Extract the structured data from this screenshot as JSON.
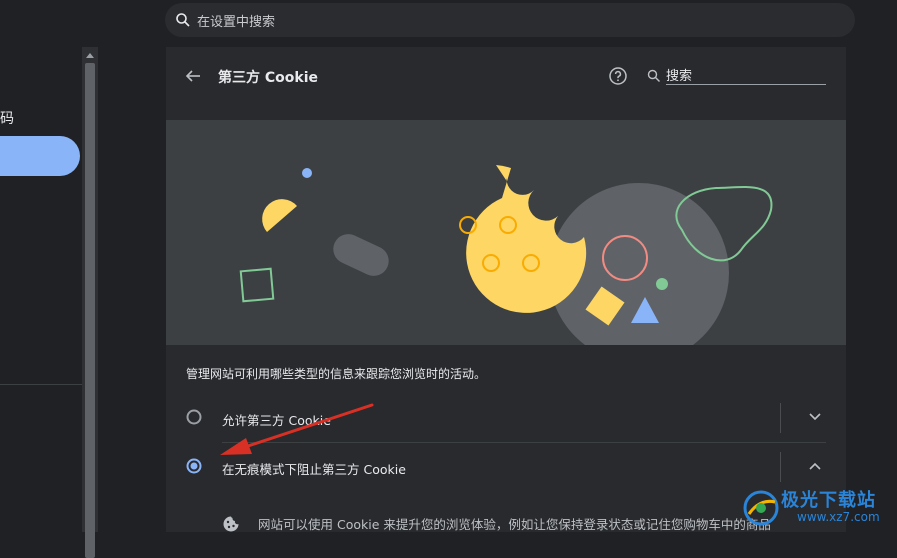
{
  "top_search": {
    "placeholder": "在设置中搜索",
    "icon": "search-icon"
  },
  "sidebar": {
    "partial_label": "码"
  },
  "page": {
    "title": "第三方 Cookie",
    "search_value": "搜索",
    "description": "管理网站可利用哪些类型的信息来跟踪您浏览时的活动。"
  },
  "options": [
    {
      "label": "允许第三方 Cookie",
      "selected": false,
      "expanded": false
    },
    {
      "label": "在无痕模式下阻止第三方 Cookie",
      "selected": true,
      "expanded": true
    }
  ],
  "detail": {
    "text": "网站可以使用 Cookie 来提升您的浏览体验，例如让您保持登录状态或记住您购物车中的商品"
  },
  "watermark": {
    "title": "极光下载站",
    "url": "www.xz7.com"
  },
  "colors": {
    "accent": "#8ab4f8",
    "background": "#202124",
    "panel": "#292a2d",
    "illustration_bg": "#3c4043",
    "cookie_yellow": "#fdd663",
    "annotation_arrow": "#d93025"
  }
}
